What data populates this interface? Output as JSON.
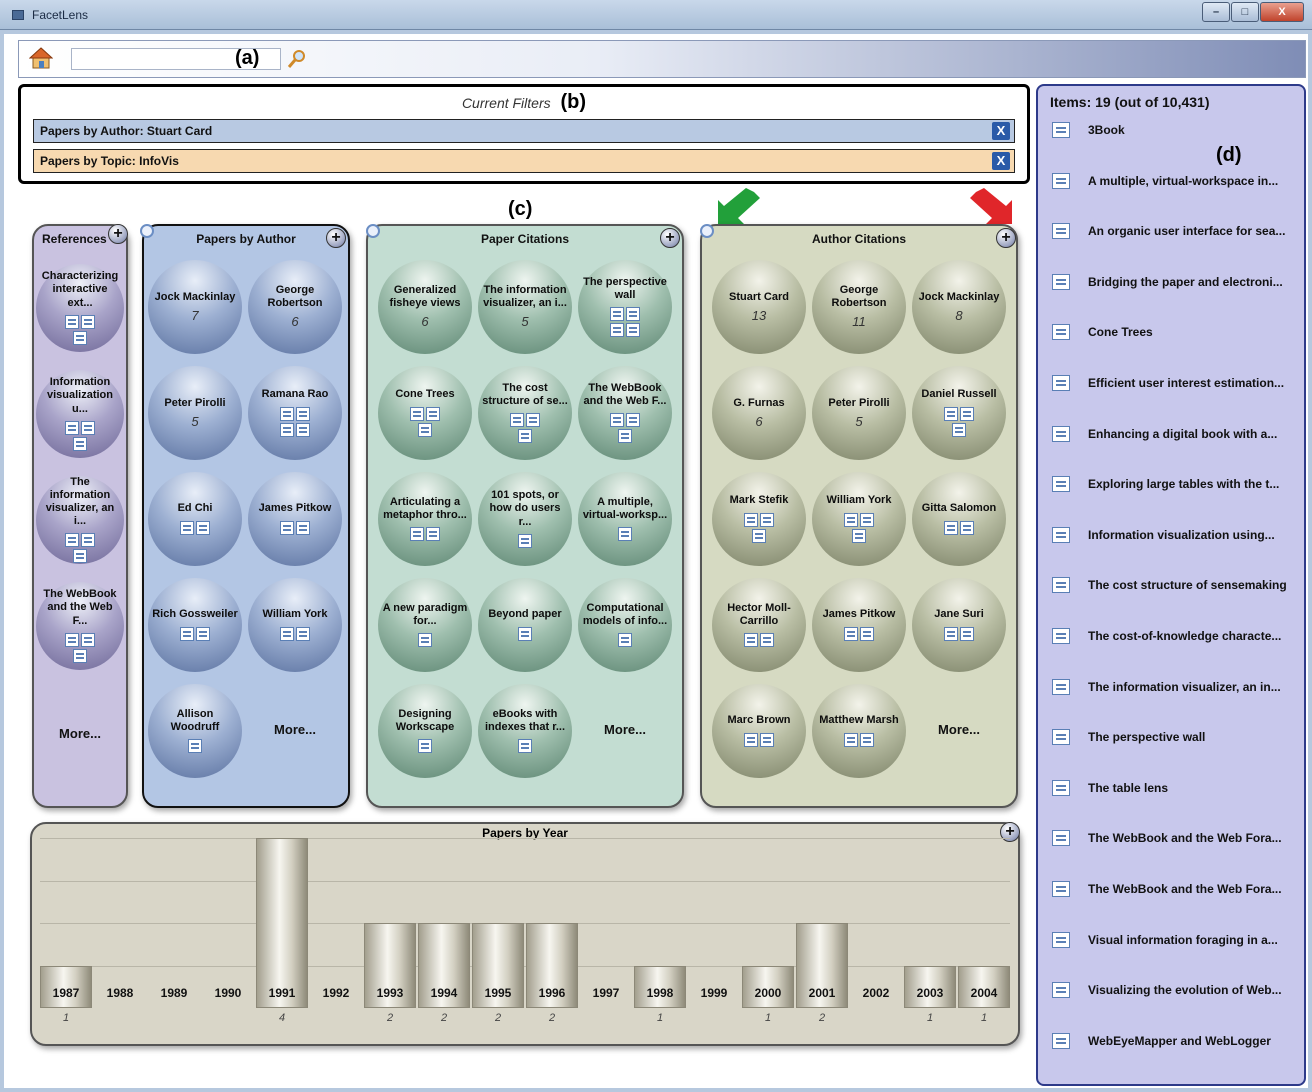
{
  "window": {
    "title": "FacetLens",
    "buttons": [
      "–",
      "□",
      "X"
    ]
  },
  "toolbar": {
    "search_value": "",
    "marker": "(a)"
  },
  "filters": {
    "caption": "Current Filters",
    "marker": "(b)",
    "items": [
      {
        "label": "Papers by Author: Stuart Card",
        "color": "#b8c9e2"
      },
      {
        "label": "Papers by Topic: InfoVis",
        "color": "#f7d9b0"
      }
    ],
    "close_glyph": "X"
  },
  "panels_marker": "(c)",
  "references": {
    "title": "References",
    "items": [
      {
        "label": "Characterizing interactive ext...",
        "docs": 3
      },
      {
        "label": "Information visualization u...",
        "docs": 3
      },
      {
        "label": "The information visualizer, an i...",
        "docs": 3
      },
      {
        "label": "The WebBook and the Web F...",
        "docs": 3
      }
    ],
    "more": "More..."
  },
  "papers_by_author": {
    "title": "Papers by Author",
    "items": [
      {
        "label": "Jock Mackinlay",
        "count": "7"
      },
      {
        "label": "George Robertson",
        "count": "6"
      },
      {
        "label": "Peter Pirolli",
        "count": "5"
      },
      {
        "label": "Ramana Rao",
        "docs": 4
      },
      {
        "label": "Ed Chi",
        "docs": 2
      },
      {
        "label": "James Pitkow",
        "docs": 2
      },
      {
        "label": "Rich Gossweiler",
        "docs": 2
      },
      {
        "label": "William York",
        "docs": 2
      },
      {
        "label": "Allison Woodruff",
        "docs": 1
      }
    ],
    "more": "More..."
  },
  "paper_citations": {
    "title": "Paper Citations",
    "items": [
      {
        "label": "Generalized fisheye views",
        "count": "6"
      },
      {
        "label": "The information visualizer, an i...",
        "count": "5"
      },
      {
        "label": "The perspective wall",
        "docs": 4
      },
      {
        "label": "Cone Trees",
        "docs": 3
      },
      {
        "label": "The cost structure of se...",
        "docs": 3
      },
      {
        "label": "The WebBook and the Web F...",
        "docs": 3
      },
      {
        "label": "Articulating a metaphor thro...",
        "docs": 2
      },
      {
        "label": "101 spots, or how do users r...",
        "docs": 1
      },
      {
        "label": "A multiple, virtual-worksp...",
        "docs": 1
      },
      {
        "label": "A new paradigm for...",
        "docs": 1
      },
      {
        "label": "Beyond paper",
        "docs": 1
      },
      {
        "label": "Computational models of info...",
        "docs": 1
      },
      {
        "label": "Designing Workscape",
        "docs": 1
      },
      {
        "label": "eBooks with indexes that r...",
        "docs": 1
      }
    ],
    "more": "More..."
  },
  "author_citations": {
    "title": "Author Citations",
    "items": [
      {
        "label": "Stuart Card",
        "count": "13"
      },
      {
        "label": "George Robertson",
        "count": "11"
      },
      {
        "label": "Jock Mackinlay",
        "count": "8"
      },
      {
        "label": "G. Furnas",
        "count": "6"
      },
      {
        "label": "Peter Pirolli",
        "count": "5"
      },
      {
        "label": "Daniel Russell",
        "docs": 3
      },
      {
        "label": "Mark Stefik",
        "docs": 3
      },
      {
        "label": "William York",
        "docs": 3
      },
      {
        "label": "Gitta Salomon",
        "docs": 2
      },
      {
        "label": "Hector Moll-Carrillo",
        "docs": 2
      },
      {
        "label": "James Pitkow",
        "docs": 2
      },
      {
        "label": "Jane Suri",
        "docs": 2
      },
      {
        "label": "Marc Brown",
        "docs": 2
      },
      {
        "label": "Matthew Marsh",
        "docs": 2
      }
    ],
    "more": "More..."
  },
  "papers_by_year": {
    "title": "Papers by Year",
    "years": [
      {
        "year": "1987",
        "count": 1
      },
      {
        "year": "1988",
        "count": 0
      },
      {
        "year": "1989",
        "count": 0
      },
      {
        "year": "1990",
        "count": 0
      },
      {
        "year": "1991",
        "count": 4
      },
      {
        "year": "1992",
        "count": 0
      },
      {
        "year": "1993",
        "count": 2
      },
      {
        "year": "1994",
        "count": 2
      },
      {
        "year": "1995",
        "count": 2
      },
      {
        "year": "1996",
        "count": 2
      },
      {
        "year": "1997",
        "count": 0
      },
      {
        "year": "1998",
        "count": 1
      },
      {
        "year": "1999",
        "count": 0
      },
      {
        "year": "2000",
        "count": 1
      },
      {
        "year": "2001",
        "count": 2
      },
      {
        "year": "2002",
        "count": 0
      },
      {
        "year": "2003",
        "count": 1
      },
      {
        "year": "2004",
        "count": 1
      }
    ],
    "max": 4
  },
  "results": {
    "title": "Items: 19 (out of 10,431)",
    "marker": "(d)",
    "items": [
      "3Book",
      "A multiple, virtual-workspace in...",
      "An organic user interface for sea...",
      "Bridging the paper and electroni...",
      "Cone Trees",
      "Efficient user interest estimation...",
      "Enhancing a digital book with a...",
      "Exploring large tables with the t...",
      "Information visualization using...",
      "The cost structure of sensemaking",
      "The cost-of-knowledge characte...",
      "The information visualizer, an in...",
      "The perspective wall",
      "The table lens",
      "The WebBook and the Web Fora...",
      "The WebBook and the Web Fora...",
      "Visual information foraging in a...",
      "Visualizing the evolution of Web...",
      "WebEyeMapper and WebLogger"
    ]
  },
  "colors": {
    "references_bg": "#c9c2e0",
    "author_bg": "#b3c6e4",
    "paper_citations_bg": "#c3ddd2",
    "author_citations_bg": "#d6dac2",
    "results_bg": "#c8c8ec",
    "arrow_green": "#22a03a",
    "arrow_red": "#e0262a"
  }
}
